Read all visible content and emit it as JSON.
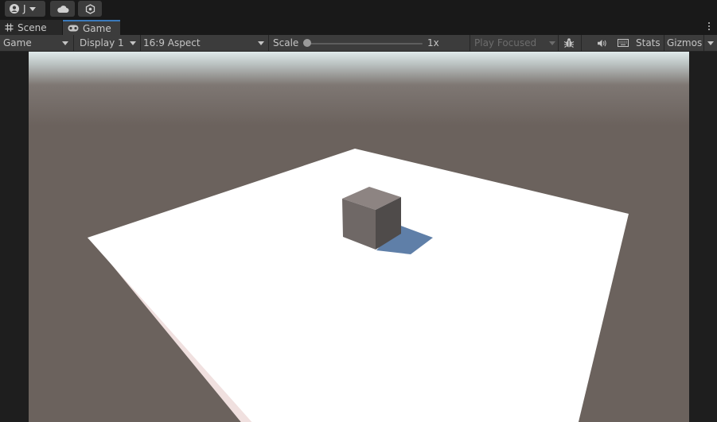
{
  "topbar": {
    "account_initial": "J",
    "account_icon": "account-circle-icon",
    "cloud_icon": "cloud-icon",
    "services_icon": "services-hexagon-icon"
  },
  "tabs": [
    {
      "label": "Scene",
      "icon": "grid-hash-icon",
      "active": false
    },
    {
      "label": "Game",
      "icon": "gamepad-icon",
      "active": true
    }
  ],
  "toolbar": {
    "view_mode": "Game",
    "display": "Display 1",
    "aspect": "16:9 Aspect",
    "scale_label": "Scale",
    "scale_value": "1x",
    "scale_fraction": 0.0,
    "play_mode": "Play Focused",
    "bug_icon": "bug-icon",
    "audio_icon": "speaker-icon",
    "keyboard_icon": "keyboard-icon",
    "stats_label": "Stats",
    "gizmos_label": "Gizmos"
  },
  "scene": {
    "sky_horizon_color": "#dfe9ea",
    "ground_color": "#6b625d",
    "plane_top_color": "#ffffff",
    "plane_side_color": "#f0e0df",
    "cube_top_color": "#8d8482",
    "cube_front_color": "#6f6866",
    "cube_side_color": "#4f4b4a",
    "shadow_color": "#5f7fa8"
  },
  "colors": {
    "panel_bg": "#3c3c3c",
    "dark_bg": "#191919",
    "active_tab_accent": "#3a79bb",
    "text": "#c4c4c4"
  }
}
